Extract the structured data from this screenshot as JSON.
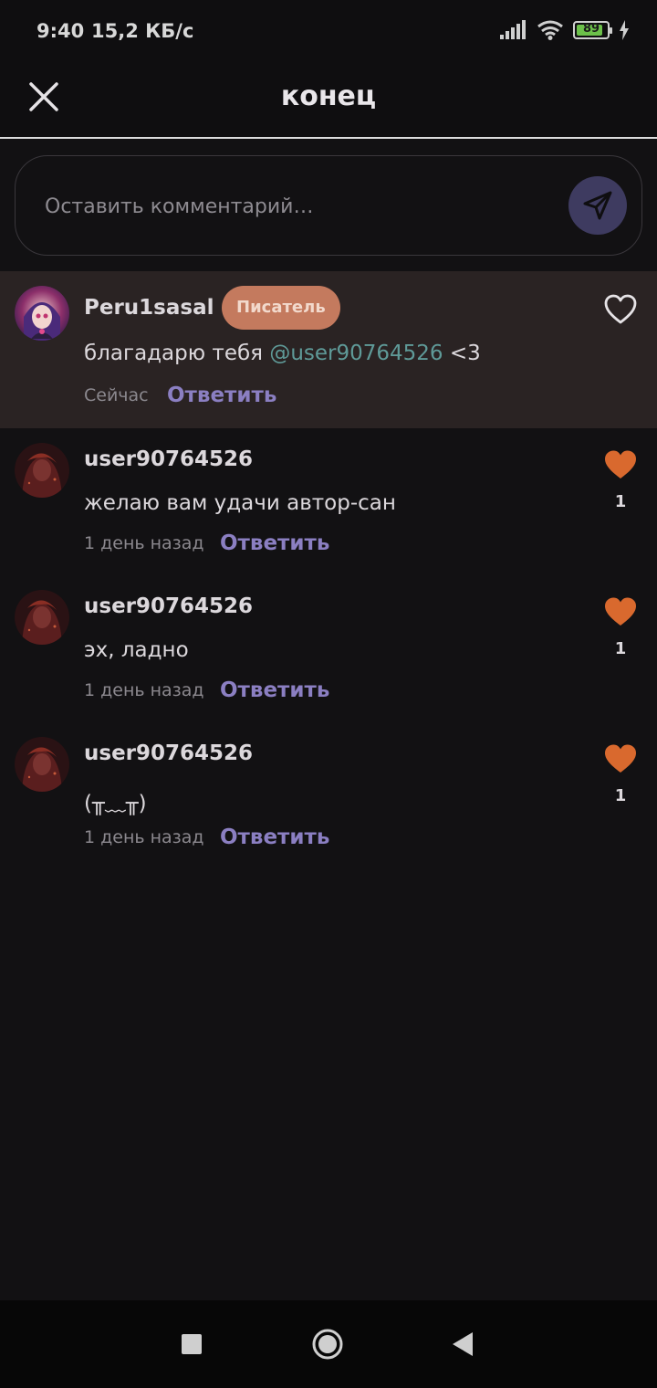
{
  "status_bar": {
    "time": "9:40",
    "speed": "15,2 КБ/с",
    "battery_level": "89",
    "battery_fraction": 0.89,
    "icons": [
      "signal-icon",
      "wifi-icon",
      "battery-icon",
      "charging-icon"
    ]
  },
  "header": {
    "title": "конец",
    "close_icon": "close-icon"
  },
  "comment_input": {
    "placeholder": "Оставить комментарий…",
    "send_icon": "send-icon"
  },
  "comments": [
    {
      "username": "Peru1sasal",
      "badge": "Писатель",
      "text_before": "благадарю тебя ",
      "mention": "@user90764526",
      "text_after": " <3",
      "time": "Сейчас",
      "reply": "Ответить",
      "liked": false
    },
    {
      "username": "user90764526",
      "text": "желаю вам удачи автор-сан",
      "time": "1 день назад",
      "reply": "Ответить",
      "likes": "1",
      "liked": true
    },
    {
      "username": "user90764526",
      "text": "эх, ладно",
      "time": "1 день назад",
      "reply": "Ответить",
      "likes": "1",
      "liked": true
    },
    {
      "username": "user90764526",
      "text": "(╥﹏╥)",
      "time": "1 день назад",
      "reply": "Ответить",
      "likes": "1",
      "liked": true
    }
  ],
  "colors": {
    "background": "#121113",
    "highlight": "#2a2323",
    "accent_reply": "#8b7fc2",
    "like": "#d9692e",
    "badge": "#c47a5e",
    "mention": "#5f9a98"
  },
  "nav_bar": {
    "icons": [
      "recent-apps-icon",
      "home-icon",
      "back-icon"
    ]
  }
}
